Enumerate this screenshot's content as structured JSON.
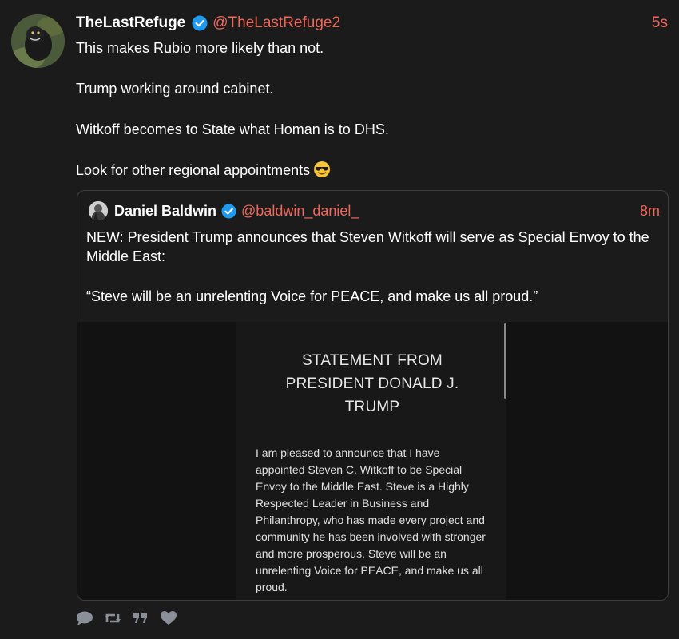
{
  "post": {
    "author_name": "TheLastRefuge",
    "author_handle": "@TheLastRefuge2",
    "timestamp": "5s",
    "paragraphs": [
      "This makes Rubio more likely than not.",
      "Trump working around cabinet.",
      "Witkoff becomes to State what Homan is to DHS.",
      "Look for other regional appointments"
    ],
    "emoji": "smiling-face-with-sunglasses"
  },
  "quote": {
    "author_name": "Daniel Baldwin",
    "author_handle": "@baldwin_daniel_",
    "timestamp": "8m",
    "paragraphs": [
      "NEW: President Trump announces that Steven Witkoff will serve as Special Envoy to the Middle East:",
      "“Steve will be an unrelenting Voice for PEACE, and make us all proud.”"
    ],
    "media": {
      "title_lines": [
        "STATEMENT FROM",
        "PRESIDENT DONALD J.",
        "TRUMP"
      ],
      "body_lines": [
        "I am pleased to announce that I have",
        "appointed Steven C. Witkoff to be Special",
        "Envoy to the Middle East. Steve is a Highly",
        "Respected Leader in Business and",
        "Philanthropy, who has made every project and",
        "community he has been involved with stronger",
        "and more prosperous. Steve will be an",
        "unrelenting Voice for PEACE, and make us all",
        "proud."
      ]
    }
  },
  "actions": [
    "reply-icon",
    "repost-icon",
    "quote-icon",
    "like-icon"
  ],
  "colors": {
    "background": "#1b1b1b",
    "accent": "#f0675a",
    "verified": "#1d9bf0",
    "icon": "#8a8f98"
  }
}
